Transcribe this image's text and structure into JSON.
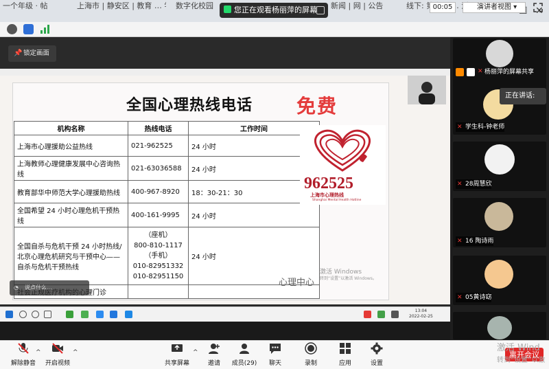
{
  "browser_tabs": [
    "一个年级 · 帖",
    "上海市 | 静安区 | 教育 … 学校",
    "数字化校园",
    "新闻 | 网 | 公告 | 新 …",
    "线下: 第六届 … 活动 …"
  ],
  "share_banner": "您正在观看杨丽萍的屏幕",
  "info_bar": {
    "timer": "00:05",
    "view_label": "演讲者视图"
  },
  "lock_button": "锁定画面",
  "slide": {
    "title": "全国心理热线电话",
    "free": "免费",
    "headers": [
      "机构名称",
      "热线电话",
      "工作时间"
    ],
    "rows": [
      {
        "name": "上海市心理援助公益热线",
        "phone": "021-962525",
        "hours": "24 小时"
      },
      {
        "name": "上海教师心理健康发展中心咨询热线",
        "phone": "021-63036588",
        "hours": "24 小时"
      },
      {
        "name": "教育部华中师范大学心理援助热线",
        "phone": "400-967-8920",
        "hours": "18：30-21：30"
      },
      {
        "name": "全国希望 24 小时心理危机干预热线",
        "phone": "400-161-9995",
        "hours": "24 小时"
      },
      {
        "name": "全国自杀与危机干预 24 小时热线/北京心理危机研究与干预中心——自杀与危机干预热线",
        "phone_lines": [
          "（座机）",
          "800-810-1117",
          "（手机）",
          "010-82951332",
          "010-82951150"
        ],
        "hours": "24 小时"
      },
      {
        "name": "社会正规医疗机构的心理门诊",
        "phone": "",
        "hours": ""
      }
    ],
    "logo_number": "962525",
    "logo_cn": "上海市心理热线",
    "logo_en": "Shanghai Mental Health Hotline",
    "footer": "心理中心",
    "win_activate": "激活 Windows",
    "win_activate_sub": "转到“设置”以激活 Windows。",
    "caption": "说点什么..."
  },
  "inner_time": [
    "13:04",
    "2022-02-25"
  ],
  "gallery": {
    "speaking_label": "正在讲话:",
    "tiles": [
      {
        "name": "杨丽萍的屏幕共享"
      },
      {
        "name": "学生科-钟老师"
      },
      {
        "name": "28周慧欣"
      },
      {
        "name": "16 陶诗雨"
      },
      {
        "name": "05黄诗窈"
      }
    ]
  },
  "toolbar": {
    "mute": "解除静音",
    "video": "开启视频",
    "share": "共享屏幕",
    "invite": "邀请",
    "members": "成员(29)",
    "chat": "聊天",
    "record": "录制",
    "apps": "应用",
    "settings": "设置",
    "leave": "离开会议",
    "win_activate": "激活 Wind",
    "win_activate_sub": "转到“设置”以激"
  },
  "colors": {
    "accent_green": "#23d96b",
    "hotline_red": "#e43c3c",
    "leave_red": "#e02828"
  }
}
